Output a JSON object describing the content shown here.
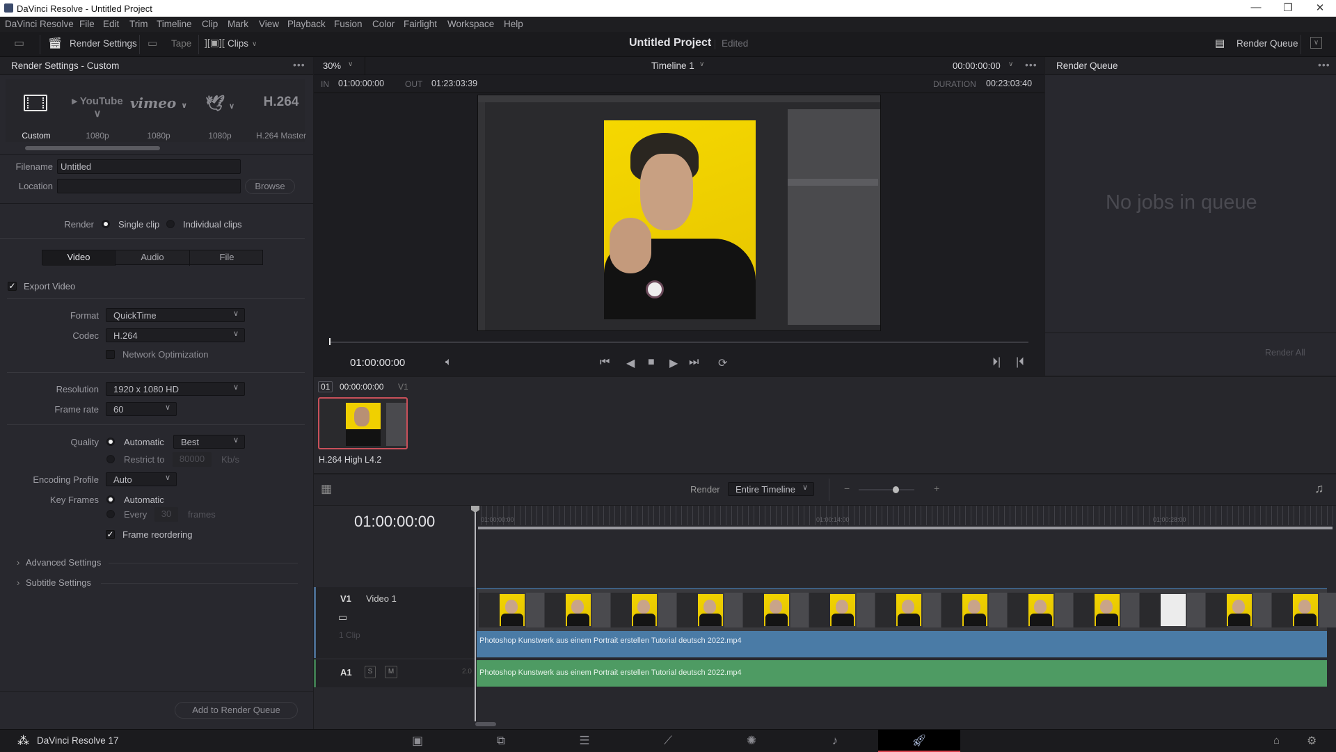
{
  "window": {
    "title": "DaVinci Resolve - Untitled Project",
    "minimize": "—",
    "maximize": "❐",
    "close": "✕"
  },
  "menu": [
    "DaVinci Resolve",
    "File",
    "Edit",
    "Trim",
    "Timeline",
    "Clip",
    "Mark",
    "View",
    "Playback",
    "Fusion",
    "Color",
    "Fairlight",
    "Workspace",
    "Help"
  ],
  "toolbar": {
    "render_settings": "Render Settings",
    "tape": "Tape",
    "clips": "Clips",
    "project_name": "Untitled Project",
    "project_status": "Edited",
    "render_queue": "Render Queue"
  },
  "render_settings": {
    "title": "Render Settings - Custom",
    "presets": [
      {
        "logo": "custom-icon",
        "caption": "Custom"
      },
      {
        "logo": "YouTube",
        "caption": "1080p"
      },
      {
        "logo": "vimeo",
        "caption": "1080p"
      },
      {
        "logo": "twitter-icon",
        "caption": "1080p"
      },
      {
        "logo": "H.264",
        "caption": "H.264 Master"
      }
    ],
    "filename_label": "Filename",
    "filename_value": "Untitled",
    "location_label": "Location",
    "location_value": "",
    "browse": "Browse",
    "render_label": "Render",
    "single_clip": "Single clip",
    "individual_clips": "Individual clips",
    "render_mode_selected": "Single clip",
    "tabs": [
      "Video",
      "Audio",
      "File"
    ],
    "active_tab": "Video",
    "export_video": "Export Video",
    "export_video_checked": true,
    "format_label": "Format",
    "format_value": "QuickTime",
    "codec_label": "Codec",
    "codec_value": "H.264",
    "network_opt": "Network Optimization",
    "network_opt_checked": false,
    "resolution_label": "Resolution",
    "resolution_value": "1920 x 1080 HD",
    "framerate_label": "Frame rate",
    "framerate_value": "60",
    "quality_label": "Quality",
    "quality_auto": "Automatic",
    "quality_auto_value": "Best",
    "quality_restrict": "Restrict to",
    "quality_restrict_value": "80000",
    "quality_unit": "Kb/s",
    "encoding_profile_label": "Encoding Profile",
    "encoding_profile_value": "Auto",
    "keyframes_label": "Key Frames",
    "keyframes_auto": "Automatic",
    "keyframes_every": "Every",
    "keyframes_every_value": "30",
    "keyframes_unit": "frames",
    "frame_reordering": "Frame reordering",
    "frame_reordering_checked": true,
    "advanced_settings": "Advanced Settings",
    "subtitle_settings": "Subtitle Settings",
    "add_to_queue": "Add to Render Queue"
  },
  "viewer": {
    "zoom": "30%",
    "timeline_name": "Timeline 1",
    "timecode_top": "00:00:00:00",
    "in_label": "IN",
    "in_value": "01:00:00:00",
    "out_label": "OUT",
    "out_value": "01:23:03:39",
    "duration_label": "DURATION",
    "duration_value": "00:23:03:40",
    "current_timecode": "01:00:00:00"
  },
  "clip_strip": {
    "index": "01",
    "timecode": "00:00:00:00",
    "track": "V1",
    "codec_caption": "H.264 High L4.2"
  },
  "render_queue": {
    "title": "Render Queue",
    "empty_message": "No jobs in queue",
    "render_all": "Render All"
  },
  "timeline": {
    "render_label": "Render",
    "render_range": "Entire Timeline",
    "zoom_minus": "−",
    "zoom_plus": "+",
    "timecode": "01:00:00:00",
    "ruler_ticks": [
      "01:00:00:00",
      "01:00:14:00",
      "01:00:28:00"
    ],
    "video_track": {
      "id": "V1",
      "name": "Video 1",
      "clip_count": "1 Clip"
    },
    "audio_track": {
      "id": "A1",
      "solo": "S",
      "mute": "M",
      "channels": "2.0"
    },
    "clip_name": "Photoshop Kunstwerk aus einem Portrait erstellen Tutorial deutsch 2022.mp4"
  },
  "statusbar": {
    "app_name": "DaVinci Resolve 17",
    "pages": [
      "media",
      "cut",
      "edit",
      "fusion",
      "color",
      "fairlight",
      "deliver"
    ],
    "active_page": "deliver"
  },
  "colors": {
    "video_clip": "#4a7ba6",
    "audio_clip": "#4e9b63",
    "active_page_underline": "#d9434f",
    "thumbnail_border": "#c9505a"
  }
}
